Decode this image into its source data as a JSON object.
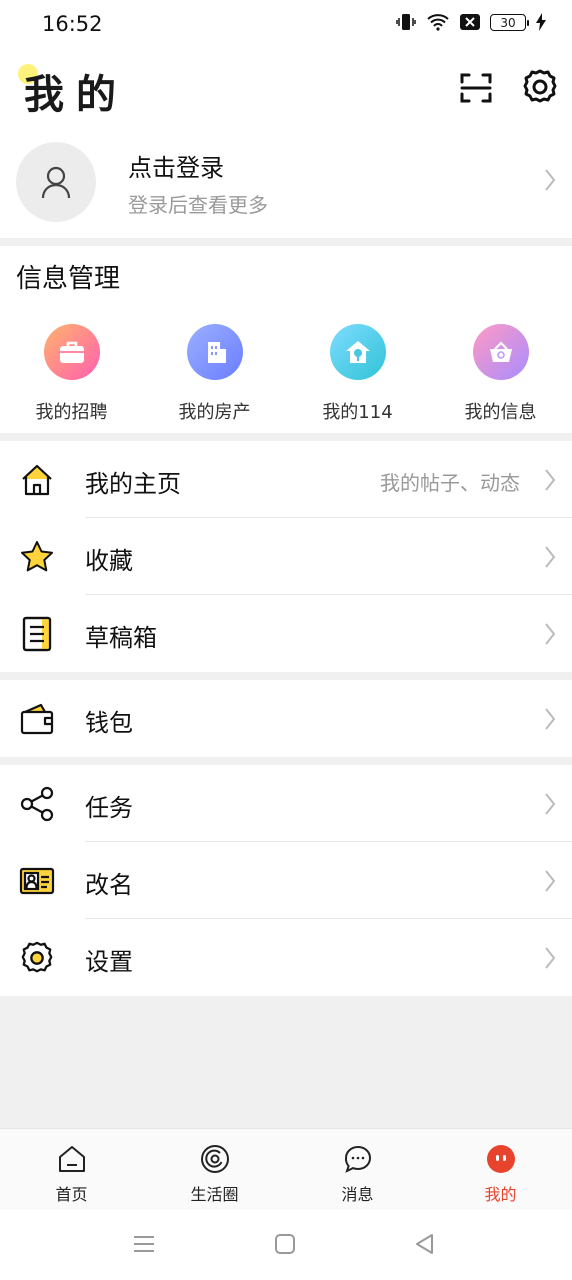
{
  "status_bar": {
    "time": "16:52",
    "battery": "30"
  },
  "header": {
    "title": "我的"
  },
  "profile": {
    "name": "点击登录",
    "subtitle": "登录后查看更多"
  },
  "info_section": {
    "title": "信息管理",
    "items": [
      {
        "label": "我的招聘",
        "icon": "briefcase-icon",
        "color": "#ff6fa3"
      },
      {
        "label": "我的房产",
        "icon": "building-icon",
        "color": "#7b8dff"
      },
      {
        "label": "我的114",
        "icon": "house-pin-icon",
        "color": "#3fc8e0"
      },
      {
        "label": "我的信息",
        "icon": "basket-icon",
        "color": "#c58cff"
      }
    ]
  },
  "menu_groups": [
    [
      {
        "label": "我的主页",
        "extra": "我的帖子、动态",
        "icon": "home-icon"
      },
      {
        "label": "收藏",
        "extra": "",
        "icon": "star-icon"
      },
      {
        "label": "草稿箱",
        "extra": "",
        "icon": "notepad-icon"
      }
    ],
    [
      {
        "label": "钱包",
        "extra": "",
        "icon": "wallet-icon"
      }
    ],
    [
      {
        "label": "任务",
        "extra": "",
        "icon": "share-icon"
      },
      {
        "label": "改名",
        "extra": "",
        "icon": "id-card-icon"
      },
      {
        "label": "设置",
        "extra": "",
        "icon": "gear-icon"
      }
    ]
  ],
  "tabs": [
    {
      "label": "首页",
      "icon": "home-tab-icon"
    },
    {
      "label": "生活圈",
      "icon": "circle-tab-icon"
    },
    {
      "label": "消息",
      "icon": "message-tab-icon"
    },
    {
      "label": "我的",
      "icon": "profile-tab-icon",
      "active": true
    }
  ],
  "colors": {
    "accent": "#ffd43b",
    "active_tab": "#e8432d"
  }
}
